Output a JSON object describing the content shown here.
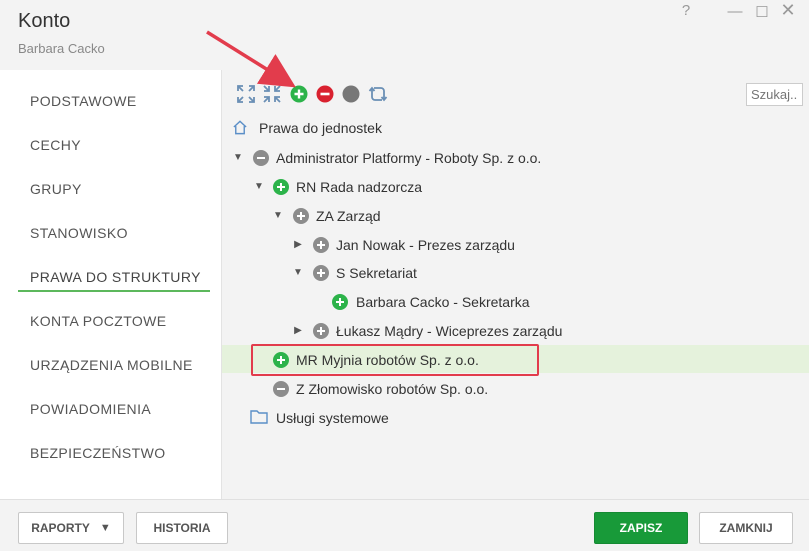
{
  "window": {
    "title": "Konto",
    "subtitle": "Barbara Cacko",
    "controls": {
      "help": "?",
      "minimize": "—",
      "maximize": "☐",
      "close": "✕"
    }
  },
  "sidebar": {
    "items": [
      {
        "label": "PODSTAWOWE"
      },
      {
        "label": "CECHY"
      },
      {
        "label": "GRUPY"
      },
      {
        "label": "STANOWISKO"
      },
      {
        "label": "PRAWA DO STRUKTURY",
        "active": true
      },
      {
        "label": "KONTA POCZTOWE"
      },
      {
        "label": "URZĄDZENIA MOBILNE"
      },
      {
        "label": "POWIADOMIENIA"
      },
      {
        "label": "BEZPIECZEŃSTWO"
      }
    ]
  },
  "toolbar": {
    "icons": [
      "expand-all-icon",
      "collapse-all-icon",
      "grant-icon",
      "revoke-icon",
      "clear-icon",
      "refresh-icon"
    ],
    "search_placeholder": "Szukaj..."
  },
  "tree": {
    "nodes": [
      {
        "label": "Prawa do jednostek",
        "icon": "home-icon"
      },
      {
        "label": "Administrator Platformy - Roboty Sp. z o.o.",
        "icon": "minus-grey",
        "expanded": true
      },
      {
        "label": "RN Rada nadzorcza",
        "icon": "plus-green",
        "expanded": true
      },
      {
        "label": "ZA Zarząd",
        "icon": "plus-grey",
        "expanded": true
      },
      {
        "label": "Jan Nowak - Prezes zarządu",
        "icon": "plus-grey",
        "expanded": false
      },
      {
        "label": "S Sekretariat",
        "icon": "plus-grey",
        "expanded": true
      },
      {
        "label": "Barbara Cacko - Sekretarka",
        "icon": "plus-green"
      },
      {
        "label": "Łukasz Mądry - Wiceprezes zarządu",
        "icon": "plus-grey",
        "expanded": false
      },
      {
        "label": "MR Myjnia robotów Sp. z o.o.",
        "icon": "plus-green",
        "selected": true
      },
      {
        "label": "Z Złomowisko robotów Sp. o.o.",
        "icon": "minus-grey"
      },
      {
        "label": "Usługi systemowe",
        "icon": "folder-icon"
      }
    ]
  },
  "footer": {
    "reports_label": "RAPORTY",
    "history_label": "HISTORIA",
    "save_label": "ZAPISZ",
    "close_label": "ZAMKNIJ"
  },
  "colors": {
    "accent_green": "#2cb34a",
    "primary_button": "#189a39",
    "annotation_red": "#e23c4c",
    "selected_row": "#e5f2dc"
  }
}
